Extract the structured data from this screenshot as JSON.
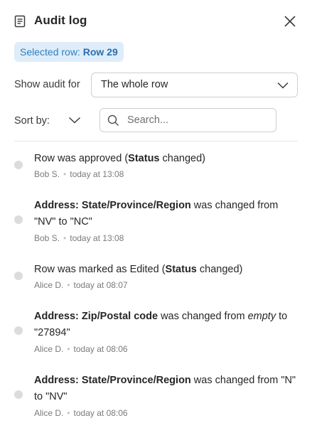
{
  "header": {
    "title": "Audit log",
    "icons": {
      "document": "document-icon",
      "close": "close-icon"
    }
  },
  "selected_row": {
    "prefix": "Selected row:",
    "value": "Row 29"
  },
  "show_audit": {
    "label": "Show audit for",
    "value": "The whole row"
  },
  "sort": {
    "label": "Sort by:"
  },
  "search": {
    "placeholder": "Search...",
    "value": ""
  },
  "entries": [
    {
      "parts": [
        {
          "t": "Row was approved ("
        },
        {
          "b": "Status"
        },
        {
          "t": " changed)"
        }
      ],
      "author": "Bob S.",
      "time": "today at 13:08"
    },
    {
      "parts": [
        {
          "b": "Address: State/Province/Region"
        },
        {
          "t": " was changed from \"NV\" to \"NC\""
        }
      ],
      "author": "Bob S.",
      "time": "today at 13:08"
    },
    {
      "parts": [
        {
          "t": "Row was marked as Edited ("
        },
        {
          "b": "Status"
        },
        {
          "t": " changed)"
        }
      ],
      "author": "Alice D.",
      "time": "today at 08:07"
    },
    {
      "parts": [
        {
          "b": "Address: Zip/Postal code"
        },
        {
          "t": " was changed from "
        },
        {
          "i": "empty"
        },
        {
          "t": " to \"27894\""
        }
      ],
      "author": "Alice D.",
      "time": "today at 08:06"
    },
    {
      "parts": [
        {
          "b": "Address: State/Province/Region"
        },
        {
          "t": " was changed from \"N\" to \"NV\""
        }
      ],
      "author": "Alice D.",
      "time": "today at 08:06"
    }
  ],
  "colors": {
    "chip_bg": "#deedf9",
    "chip_text": "#2f7fc1",
    "dot": "#dcdcdc",
    "meta_text": "#7a7a7a"
  }
}
